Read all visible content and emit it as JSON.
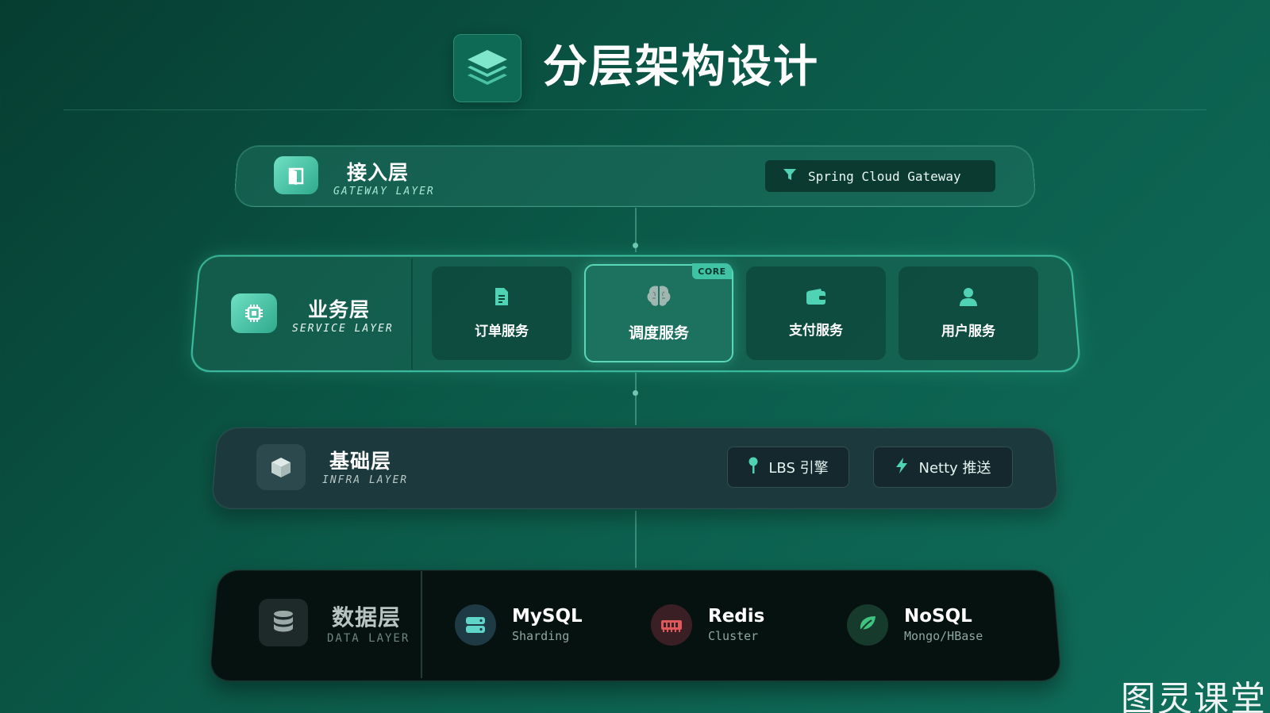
{
  "title": "分层架构设计",
  "title_icon": "layers-icon",
  "accent_color": "#3fc3a4",
  "layers": {
    "gateway": {
      "name": "接入层",
      "subtitle": "GATEWAY LAYER",
      "icon": "door-icon",
      "chip": {
        "icon": "filter-icon",
        "label": "Spring Cloud Gateway"
      }
    },
    "service": {
      "name": "业务层",
      "subtitle": "SERVICE LAYER",
      "icon": "chip-icon",
      "cards": [
        {
          "label": "订单服务",
          "icon": "document-icon"
        },
        {
          "label": "调度服务",
          "icon": "brain-icon",
          "badge": "CORE"
        },
        {
          "label": "支付服务",
          "icon": "wallet-icon"
        },
        {
          "label": "用户服务",
          "icon": "user-icon"
        }
      ]
    },
    "infra": {
      "name": "基础层",
      "subtitle": "INFRA LAYER",
      "icon": "cube-icon",
      "chips": [
        {
          "label": "LBS 引擎",
          "icon": "map-pin-icon"
        },
        {
          "label": "Netty 推送",
          "icon": "bolt-icon"
        }
      ]
    },
    "data": {
      "name": "数据层",
      "subtitle": "DATA LAYER",
      "icon": "database-icon",
      "stores": [
        {
          "name": "MySQL",
          "sub": "Sharding",
          "icon": "server-icon",
          "color": "#5fd4c8"
        },
        {
          "name": "Redis",
          "sub": "Cluster",
          "icon": "memory-icon",
          "color": "#e0585a"
        },
        {
          "name": "NoSQL",
          "sub": "Mongo/HBase",
          "icon": "leaf-icon",
          "color": "#3fc37f"
        }
      ]
    }
  },
  "watermark": "图灵课堂"
}
